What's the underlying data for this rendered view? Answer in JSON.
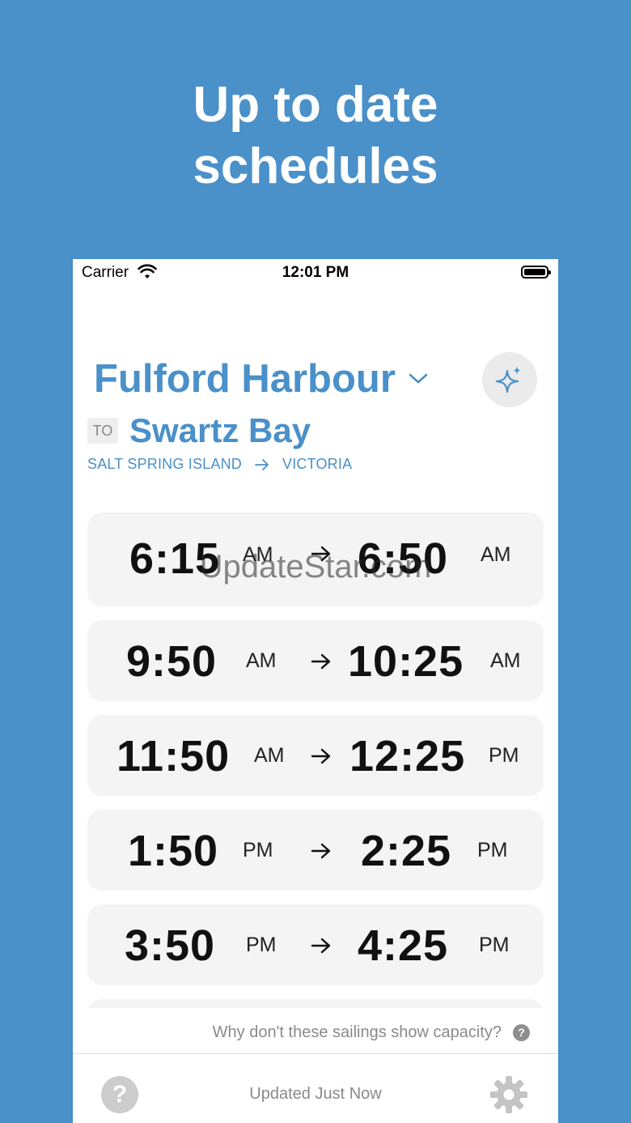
{
  "promo": {
    "line1": "Up to date",
    "line2": "schedules"
  },
  "status_bar": {
    "carrier": "Carrier",
    "time": "12:01 PM"
  },
  "route": {
    "origin": "Fulford Harbour",
    "to_label": "TO",
    "destination": "Swartz Bay",
    "origin_region": "SALT SPRING ISLAND",
    "destination_region": "VICTORIA"
  },
  "sailings": [
    {
      "depart": "6:15",
      "depart_ampm": "AM",
      "arrive": "6:50",
      "arrive_ampm": "AM"
    },
    {
      "depart": "9:50",
      "depart_ampm": "AM",
      "arrive": "10:25",
      "arrive_ampm": "AM"
    },
    {
      "depart": "11:50",
      "depart_ampm": "AM",
      "arrive": "12:25",
      "arrive_ampm": "PM"
    },
    {
      "depart": "1:50",
      "depart_ampm": "PM",
      "arrive": "2:25",
      "arrive_ampm": "PM"
    },
    {
      "depart": "3:50",
      "depart_ampm": "PM",
      "arrive": "4:25",
      "arrive_ampm": "PM"
    }
  ],
  "capacity_note": "Why don't these sailings show capacity?",
  "help_glyph": "?",
  "footer": {
    "updated": "Updated Just Now",
    "help_glyph": "?"
  },
  "watermark": "UpdateStar.com",
  "colors": {
    "accent": "#4a90c9",
    "card": "#f4f4f4",
    "muted": "#8a8a8a"
  },
  "icons": {
    "chevron": "chevron-down-icon",
    "sparkle": "sparkle-icon",
    "route_arrow": "arrow-right-icon",
    "help": "question-circle-icon",
    "settings": "gear-icon"
  }
}
